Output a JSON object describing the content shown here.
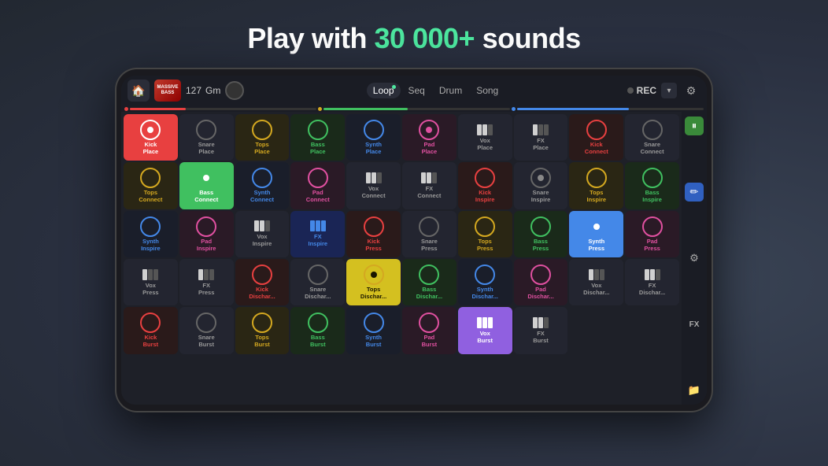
{
  "headline": {
    "before": "Play with ",
    "accent": "30 000+",
    "after": " sounds"
  },
  "topbar": {
    "bpm": "127",
    "key": "Gm",
    "tabs": [
      "Loop",
      "Seq",
      "Drum",
      "Song"
    ],
    "active_tab": "Loop",
    "rec_label": "REC",
    "track_label": "MASSIVE\nBASS"
  },
  "grid": {
    "rows": [
      "Place",
      "Connect",
      "Inspire",
      "Press",
      "Dischar...",
      "Burst"
    ],
    "columns": [
      {
        "name": "Kick",
        "color": "red"
      },
      {
        "name": "Snare",
        "color": "gray"
      },
      {
        "name": "Tops",
        "color": "yellow"
      },
      {
        "name": "Bass",
        "color": "green"
      },
      {
        "name": "Synth",
        "color": "blue"
      },
      {
        "name": "Pad",
        "color": "pink"
      },
      {
        "name": "Vox",
        "color": "bars"
      },
      {
        "name": "FX",
        "color": "bars"
      }
    ],
    "active_cells": [
      {
        "row": 0,
        "col": 0
      },
      {
        "row": 1,
        "col": 3
      },
      {
        "row": 3,
        "col": 4
      },
      {
        "row": 4,
        "col": 2
      }
    ]
  },
  "sidebar_buttons": [
    "pause",
    "edit",
    "mixer",
    "fx",
    "folder"
  ]
}
